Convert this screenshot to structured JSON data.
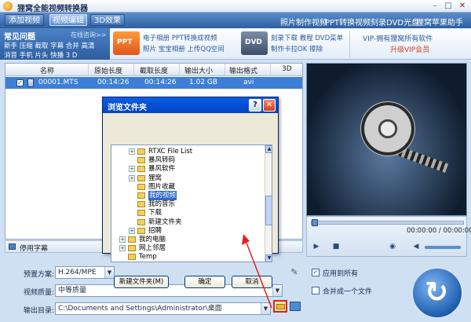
{
  "window": {
    "title": "狸窝全能视频转换器"
  },
  "toolbar": {
    "tabs": [
      {
        "label": "添加视频"
      },
      {
        "label": "视频编辑"
      },
      {
        "label": "3D效果"
      }
    ],
    "links": [
      {
        "label": "照片制作视频"
      },
      {
        "label": "PPT转换视频"
      },
      {
        "label": "刻录DVD光盘"
      },
      {
        "label": "狸窝苹果助手"
      }
    ]
  },
  "faq": {
    "title": "常见问题",
    "online": "在线咨询>>",
    "line1": "新手 压缩 截取 字幕 合并 高清",
    "line2": "消音 手机 片头 快播 3 D"
  },
  "promos": {
    "p1a": "电子相册 PPT转换成视频",
    "p1b": "照片 宝宝相册 上传QQ空间",
    "p2a": "刻录下载 教程 DVD菜单",
    "p2b": "制作卡拉OK 擦除",
    "vip1": "VIP-拥有狸窝所有软件",
    "vip2": "升级VIP会员"
  },
  "table": {
    "headers": [
      "名称",
      "原始长度",
      "截取长度",
      "输出大小",
      "输出格式",
      "3D"
    ],
    "rows": [
      {
        "name": "00001.MTS",
        "orig": "00:14:26",
        "cut": "00:14:26",
        "size": "1.02 GB",
        "format": "avi"
      }
    ]
  },
  "subtitle": {
    "label": "停用字幕"
  },
  "settings": {
    "preset_label": "预置方案:",
    "preset_value": "H.264/MPE",
    "quality_label": "视频质量:",
    "quality_value": "中等质量",
    "output_label": "输出目录:",
    "output_value": "C:\\Documents and Settings\\Administrator\\桌面",
    "apply_all": "应用到所有",
    "merge": "合并成一个文件"
  },
  "player": {
    "time": "00:00:00 / 00:00:00"
  },
  "dialog": {
    "title": "浏览文件夹",
    "tree": [
      {
        "label": "RTXC File List",
        "exp": "+"
      },
      {
        "label": "暴风转码",
        "exp": ""
      },
      {
        "label": "暴风软件",
        "exp": "+"
      },
      {
        "label": "狸窝",
        "exp": "+"
      },
      {
        "label": "图片收藏",
        "exp": ""
      },
      {
        "label": "我的视频",
        "exp": "",
        "selected": true
      },
      {
        "label": "我的音乐",
        "exp": ""
      },
      {
        "label": "下载",
        "exp": ""
      },
      {
        "label": "新建文件夹",
        "exp": ""
      },
      {
        "label": "招聘",
        "exp": "+"
      },
      {
        "label": "我的电脑",
        "exp": "+"
      },
      {
        "label": "网上邻居",
        "exp": "+"
      },
      {
        "label": "Temp",
        "exp": ""
      }
    ],
    "btn_new": "新建文件夹(M)",
    "btn_ok": "确定",
    "btn_cancel": "取消"
  },
  "icons": [
    "app-icon",
    "ppt-icon",
    "dvd-icon",
    "file-icon",
    "subtitle-icon",
    "wrench-icon",
    "folder-icon",
    "open-folder-icon",
    "convert-icon",
    "film-reel-icon",
    "play-icon",
    "stop-icon",
    "camera-icon",
    "volume-icon"
  ],
  "colors": {
    "toolbar": "#2e5f9f",
    "selection": "#3d7fd6",
    "dialog_title": "#0a5ee2",
    "highlight": "#e02020"
  }
}
